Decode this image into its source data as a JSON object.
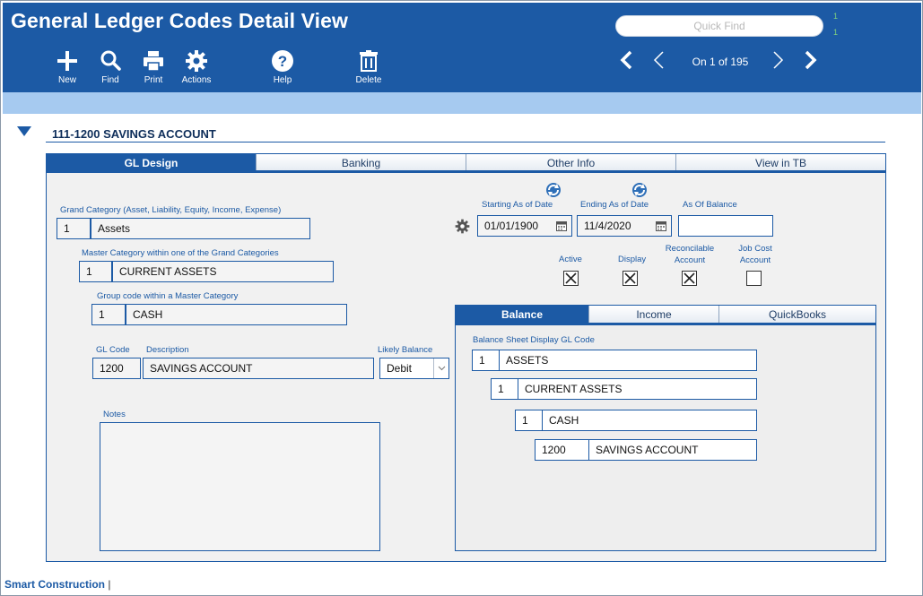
{
  "header": {
    "title": "General Ledger Codes Detail View",
    "quick_find_placeholder": "Quick Find",
    "qf_mark_1": "1",
    "qf_mark_2": "1",
    "record_position": "On 1 of 195"
  },
  "toolbar": {
    "new_label": "New",
    "find_label": "Find",
    "print_label": "Print",
    "actions_label": "Actions",
    "help_label": "Help",
    "delete_label": "Delete"
  },
  "section": {
    "title": "111-1200  SAVINGS ACCOUNT"
  },
  "tabs": [
    "GL Design",
    "Banking",
    "Other Info",
    "View in TB"
  ],
  "form": {
    "grand_category_label": "Grand Category (Asset, Liability, Equity, Income, Expense)",
    "grand_category_code": "1",
    "grand_category_name": "Assets",
    "master_category_label": "Master Category within one of the Grand Categories",
    "master_category_code": "1",
    "master_category_name": "CURRENT ASSETS",
    "group_code_label": "Group code within a Master Category",
    "group_code": "1",
    "group_name": "CASH",
    "gl_code_label": "GL Code",
    "description_label": "Description",
    "likely_balance_label": "Likely Balance",
    "gl_code": "1200",
    "description": "SAVINGS ACCOUNT",
    "likely_balance": "Debit",
    "notes_label": "Notes",
    "starting_label": "Starting As of Date",
    "ending_label": "Ending As of Date",
    "as_of_balance_label": "As Of Balance",
    "starting_date": "01/01/1900",
    "ending_date": "11/4/2020",
    "as_of_balance": "",
    "active_label": "Active",
    "display_label": "Display",
    "reconcilable_label": "Reconcilable Account",
    "job_cost_label": "Job Cost Account",
    "active": true,
    "display": true,
    "reconcilable": true,
    "job_cost": false
  },
  "subtabs": [
    "Balance",
    "Income",
    "QuickBooks"
  ],
  "balance": {
    "label": "Balance Sheet Display GL Code",
    "rows": [
      {
        "code": "1",
        "name": "ASSETS"
      },
      {
        "code": "1",
        "name": "CURRENT ASSETS"
      },
      {
        "code": "1",
        "name": "CASH"
      },
      {
        "code": "1200",
        "name": "SAVINGS ACCOUNT"
      }
    ]
  },
  "footer": {
    "app_name": "Smart Construction",
    "separator": "|"
  },
  "colors": {
    "primary": "#1c5aa5",
    "strip": "#a6caf0"
  }
}
